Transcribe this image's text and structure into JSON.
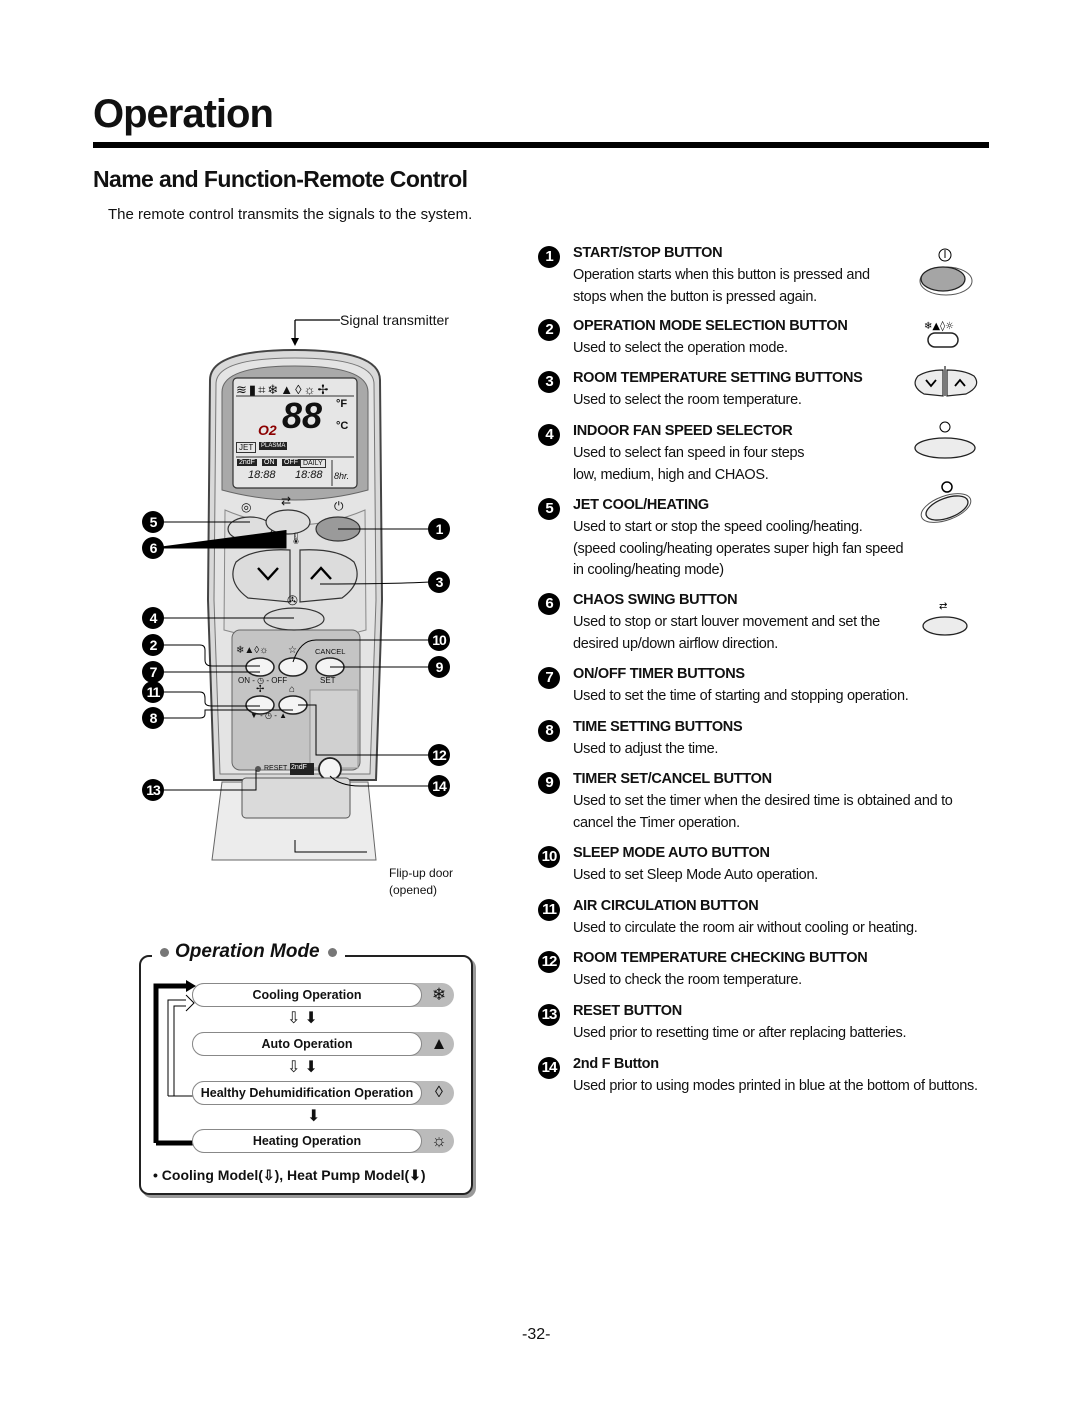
{
  "page": {
    "title": "Operation",
    "section_title": "Name and Function-Remote Control",
    "intro": "The remote control transmits the signals to the system.",
    "page_number": "-32-"
  },
  "remote": {
    "signal_label": "Signal transmitter",
    "flip_door_label_1": "Flip-up door",
    "flip_door_label_2": "(opened)",
    "display": {
      "temp_digits": "88",
      "unit_f": "°F",
      "unit_c": "°C",
      "jet": "JET",
      "plasma": "PLASMA",
      "second_f": "2ndF",
      "on": "ON",
      "off": "OFF",
      "daily": "DAILY",
      "time_on": "18:88",
      "time_off": "18:88",
      "hours": "8hr.",
      "o2": "O2"
    },
    "button_labels": {
      "cancel": "CANCEL",
      "set": "SET",
      "on_off": "ON - ◷ - OFF",
      "time_adj": "▼ - ◷ - ▲",
      "reset": "RESET",
      "second_f": "2ndF"
    },
    "callouts": {
      "left": [
        "5",
        "6",
        "4",
        "2",
        "7",
        "11",
        "8",
        "13"
      ],
      "right": [
        "1",
        "3",
        "10",
        "9",
        "12",
        "14"
      ]
    }
  },
  "items": [
    {
      "num": "1",
      "heading": "START/STOP BUTTON",
      "desc": [
        "Operation starts when this button is pressed and",
        "stops when the button is pressed again."
      ],
      "icon": "power-button-icon"
    },
    {
      "num": "2",
      "heading": "OPERATION MODE SELECTION BUTTON",
      "desc": [
        "Used to select the operation mode."
      ],
      "icon": "mode-button-icon"
    },
    {
      "num": "3",
      "heading": "ROOM TEMPERATURE SETTING BUTTONS",
      "desc": [
        "Used to select the room temperature."
      ],
      "icon": "temp-up-down-icon"
    },
    {
      "num": "4",
      "heading": "INDOOR FAN SPEED SELECTOR",
      "desc": [
        "Used to select fan speed in four steps",
        "low, medium, high and CHAOS."
      ],
      "icon": "fan-button-icon"
    },
    {
      "num": "5",
      "heading": "JET COOL/HEATING",
      "desc": [
        "Used to start or stop the speed cooling/heating.",
        "(speed cooling/heating operates super high fan speed",
        "in cooling/heating mode)"
      ],
      "icon": "jet-button-icon"
    },
    {
      "num": "6",
      "heading": "CHAOS SWING BUTTON",
      "desc": [
        "Used to stop or start louver movement and set the",
        "desired up/down airflow direction."
      ],
      "icon": "swing-button-icon"
    },
    {
      "num": "7",
      "heading": "ON/OFF TIMER BUTTONS",
      "desc": [
        "Used to set the time of starting and stopping operation."
      ]
    },
    {
      "num": "8",
      "heading": "TIME SETTING BUTTONS",
      "desc": [
        "Used to adjust the time."
      ]
    },
    {
      "num": "9",
      "heading": "TIMER SET/CANCEL BUTTON",
      "desc": [
        "Used to set the timer when the desired time is obtained and to",
        "cancel the Timer operation."
      ]
    },
    {
      "num": "10",
      "heading": "SLEEP MODE AUTO BUTTON",
      "desc": [
        "Used to set Sleep Mode Auto operation."
      ]
    },
    {
      "num": "11",
      "heading": "AIR CIRCULATION BUTTON",
      "desc": [
        "Used to circulate the room air without cooling or heating."
      ]
    },
    {
      "num": "12",
      "heading": "ROOM TEMPERATURE CHECKING BUTTON",
      "desc": [
        "Used to check the room temperature."
      ]
    },
    {
      "num": "13",
      "heading": "RESET BUTTON",
      "desc": [
        "Used prior to resetting time or after replacing batteries."
      ]
    },
    {
      "num": "14",
      "heading": "2nd F Button",
      "desc": [
        "Used prior to using modes printed in blue at the bottom of buttons."
      ]
    }
  ],
  "operation_mode": {
    "title": "Operation Mode",
    "modes": [
      {
        "label": "Cooling Operation",
        "icon": "snowflake-icon",
        "glyph": "❄"
      },
      {
        "label": "Auto Operation",
        "icon": "auto-icon",
        "glyph": "▲"
      },
      {
        "label": "Healthy Dehumidification Operation",
        "icon": "droplet-icon",
        "glyph": "💧"
      },
      {
        "label": "Heating Operation",
        "icon": "sun-icon",
        "glyph": "☼"
      }
    ],
    "footnote": "• Cooling Model(⇩), Heat Pump Model(⬇)"
  }
}
